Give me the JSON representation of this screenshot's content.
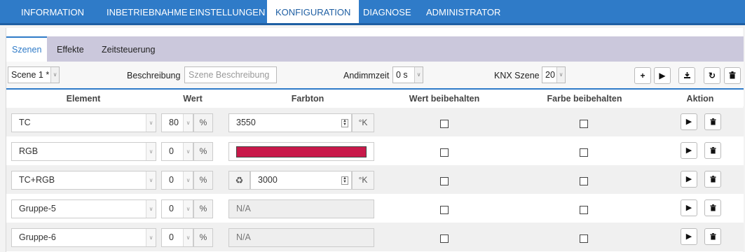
{
  "topnav": {
    "items": [
      {
        "label": "INFORMATION"
      },
      {
        "label": "INBETRIEBNAHME"
      },
      {
        "label": "EINSTELLUNGEN"
      },
      {
        "label": "KONFIGURATION"
      },
      {
        "label": "DIAGNOSE"
      },
      {
        "label": "ADMINISTRATOR"
      }
    ],
    "active": "KONFIGURATION"
  },
  "subtabs": {
    "items": [
      {
        "label": "Szenen"
      },
      {
        "label": "Effekte"
      },
      {
        "label": "Zeitsteuerung"
      }
    ],
    "active": "Szenen"
  },
  "toolbar": {
    "scene_value": "Scene 1 *",
    "beschreibung_label": "Beschreibung",
    "beschreibung_placeholder": "Szene Beschreibung",
    "andimmzeit_label": "Andimmzeit",
    "andimmzeit_value": "0 s",
    "knx_label": "KNX Szene",
    "knx_value": "20",
    "buttons": [
      "plus-icon",
      "play-icon",
      "download-icon",
      "refresh-icon",
      "trash-icon"
    ]
  },
  "table": {
    "headers": {
      "element": "Element",
      "wert": "Wert",
      "farbton": "Farbton",
      "wert_beibehalten": "Wert beibehalten",
      "farbe_beibehalten": "Farbe beibehalten",
      "aktion": "Aktion"
    },
    "rows": [
      {
        "element": "TC",
        "wert": "80",
        "unit": "%",
        "farbton_type": "temperature",
        "farbton_value": "3550",
        "farbton_unit": "°K"
      },
      {
        "element": "RGB",
        "wert": "0",
        "unit": "%",
        "farbton_type": "rgb",
        "farbton_color": "#c8194a"
      },
      {
        "element": "TC+RGB",
        "wert": "0",
        "unit": "%",
        "farbton_type": "temperature-recycle",
        "farbton_value": "3000",
        "farbton_unit": "°K"
      },
      {
        "element": "Gruppe-5",
        "wert": "0",
        "unit": "%",
        "farbton_type": "na",
        "farbton_value": "N/A"
      },
      {
        "element": "Gruppe-6",
        "wert": "0",
        "unit": "%",
        "farbton_type": "na",
        "farbton_value": "N/A"
      }
    ]
  },
  "colors": {
    "nav_blue": "#2f7bc8",
    "subtab_bar": "#cbc8dc",
    "rgb_swatch": "#c8194a"
  }
}
